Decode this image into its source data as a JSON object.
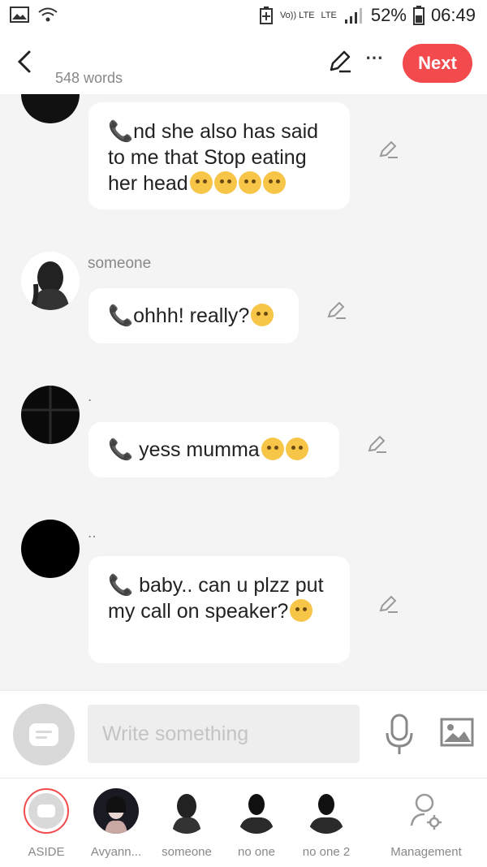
{
  "status_bar": {
    "battery": "52%",
    "time": "06:49",
    "network": "LTE",
    "volte": "Vo)) LTE"
  },
  "header": {
    "word_count": "548 words",
    "next_label": "Next"
  },
  "messages": [
    {
      "sender": "",
      "text": "📞nd she also has said to me that Stop eating her head"
    },
    {
      "sender": "someone",
      "text": "📞ohhh! really?"
    },
    {
      "sender": ".",
      "text": "📞 yess mumma"
    },
    {
      "sender": "..",
      "text": "📞 baby.. can u plzz put my call on speaker?"
    }
  ],
  "composer": {
    "placeholder": "Write something"
  },
  "characters": [
    {
      "label": "ASIDE"
    },
    {
      "label": "Avyann..."
    },
    {
      "label": "someone"
    },
    {
      "label": "no one"
    },
    {
      "label": "no one 2"
    },
    {
      "label": "Management"
    }
  ],
  "colors": {
    "accent": "#f24a4d",
    "emoji": "#f7c548"
  },
  "icons": [
    "back-icon",
    "pencil-icon",
    "more-icon",
    "mic-icon",
    "image-icon",
    "settings-person-icon"
  ]
}
